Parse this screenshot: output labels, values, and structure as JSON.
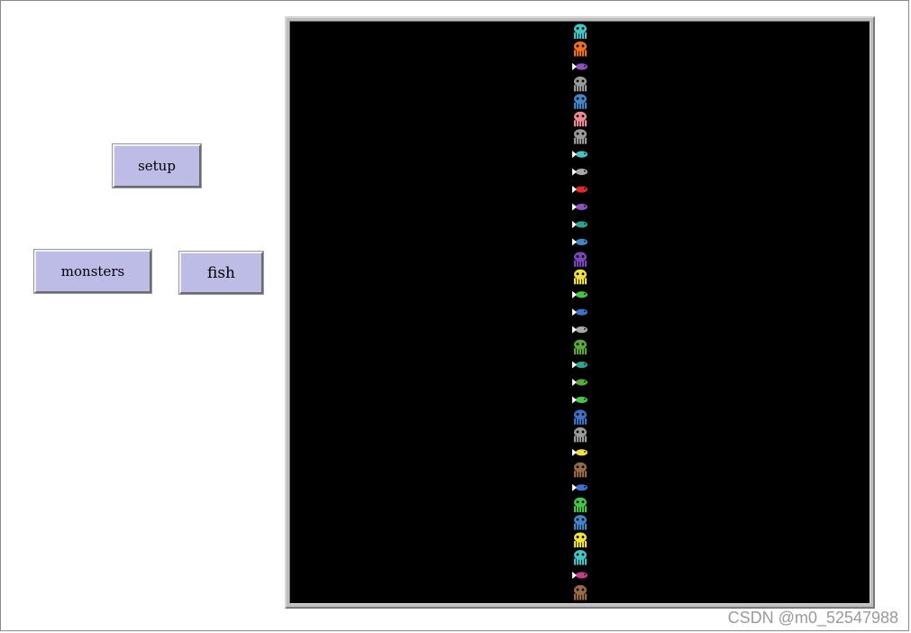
{
  "buttons": {
    "setup": "setup",
    "monsters": "monsters",
    "fish": "fish"
  },
  "watermark": "CSDN @m0_52547988",
  "world": {
    "background": "#000000",
    "agents": [
      {
        "kind": "monster",
        "color": "#44c4c4"
      },
      {
        "kind": "monster",
        "color": "#f07020"
      },
      {
        "kind": "fish",
        "color": "#8e4fc0"
      },
      {
        "kind": "monster",
        "color": "#9a9a9a"
      },
      {
        "kind": "monster",
        "color": "#3f86c8"
      },
      {
        "kind": "monster",
        "color": "#e98a95"
      },
      {
        "kind": "monster",
        "color": "#9a9a9a"
      },
      {
        "kind": "fish",
        "color": "#44c4c4"
      },
      {
        "kind": "fish",
        "color": "#a8a8a8"
      },
      {
        "kind": "fish",
        "color": "#e02a2a"
      },
      {
        "kind": "fish",
        "color": "#8e4fc0"
      },
      {
        "kind": "fish",
        "color": "#2aa58f"
      },
      {
        "kind": "fish",
        "color": "#3f86c8"
      },
      {
        "kind": "monster",
        "color": "#7a45b8"
      },
      {
        "kind": "monster",
        "color": "#f0e040"
      },
      {
        "kind": "fish",
        "color": "#46c446"
      },
      {
        "kind": "fish",
        "color": "#3f6fc8"
      },
      {
        "kind": "fish",
        "color": "#a8a8a8"
      },
      {
        "kind": "monster",
        "color": "#5aa83a"
      },
      {
        "kind": "fish",
        "color": "#2aa58f"
      },
      {
        "kind": "fish",
        "color": "#5aa83a"
      },
      {
        "kind": "fish",
        "color": "#46c446"
      },
      {
        "kind": "monster",
        "color": "#3f6fc8"
      },
      {
        "kind": "monster",
        "color": "#9a9a9a"
      },
      {
        "kind": "fish",
        "color": "#f0e040"
      },
      {
        "kind": "monster",
        "color": "#9a6a45"
      },
      {
        "kind": "fish",
        "color": "#3f6fc8"
      },
      {
        "kind": "monster",
        "color": "#46c446"
      },
      {
        "kind": "monster",
        "color": "#3f86c8"
      },
      {
        "kind": "monster",
        "color": "#f0e040"
      },
      {
        "kind": "monster",
        "color": "#44c4c4"
      },
      {
        "kind": "fish",
        "color": "#c83a8a"
      },
      {
        "kind": "monster",
        "color": "#9a6a45"
      }
    ]
  }
}
